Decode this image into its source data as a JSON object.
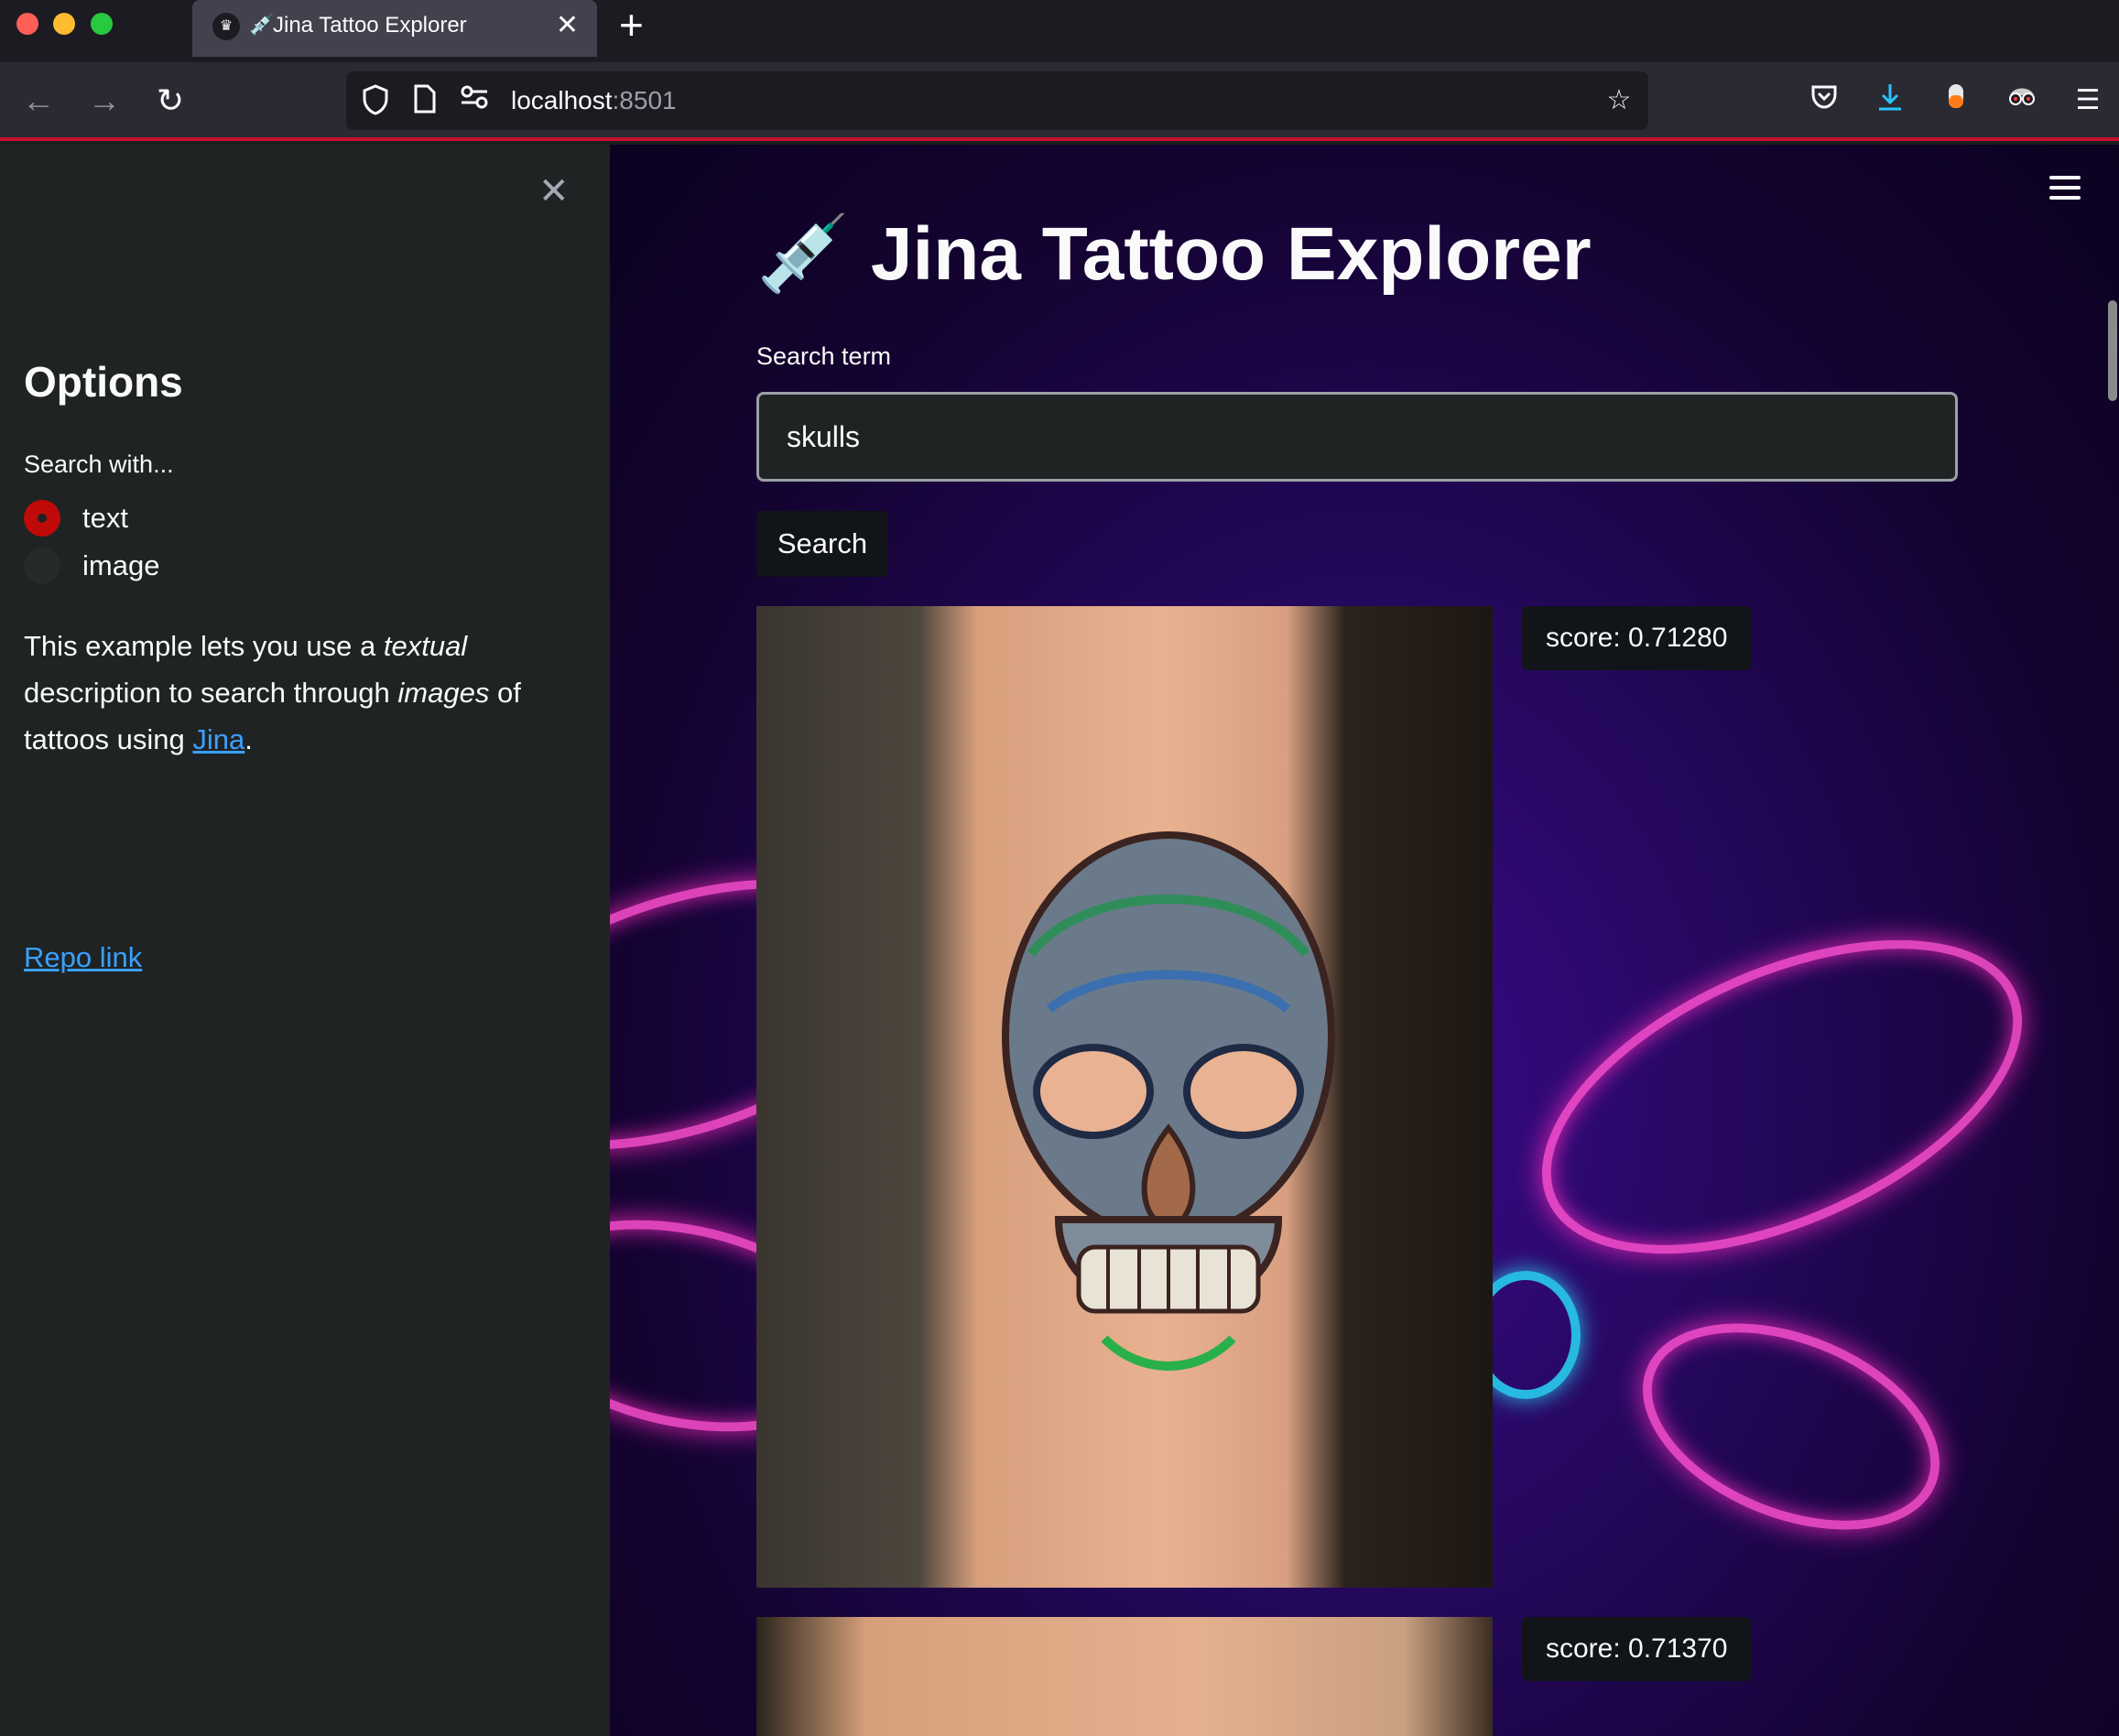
{
  "browser": {
    "tab_emoji": "💉",
    "tab_title": "Jina Tattoo Explorer",
    "url_host": "localhost",
    "url_port": ":8501"
  },
  "sidebar": {
    "title": "Options",
    "radio_label": "Search with...",
    "options": [
      {
        "label": "text",
        "selected": true
      },
      {
        "label": "image",
        "selected": false
      }
    ],
    "desc_1": "This example lets you use a ",
    "desc_em1": "textual",
    "desc_2": " description to search through ",
    "desc_em2": "images",
    "desc_3": " of tattoos using ",
    "desc_link": "Jina",
    "desc_4": ".",
    "repo_link": "Repo link"
  },
  "main": {
    "title": "💉 Jina Tattoo Explorer",
    "search_label": "Search term",
    "search_value": "skulls",
    "search_button": "Search",
    "results": [
      {
        "score": "score: 0.71280"
      },
      {
        "score": "score: 0.71370"
      }
    ]
  },
  "colors": {
    "accent": "#c00a0a",
    "link": "#3aa0ff",
    "sidebar_bg": "#1f2323"
  }
}
